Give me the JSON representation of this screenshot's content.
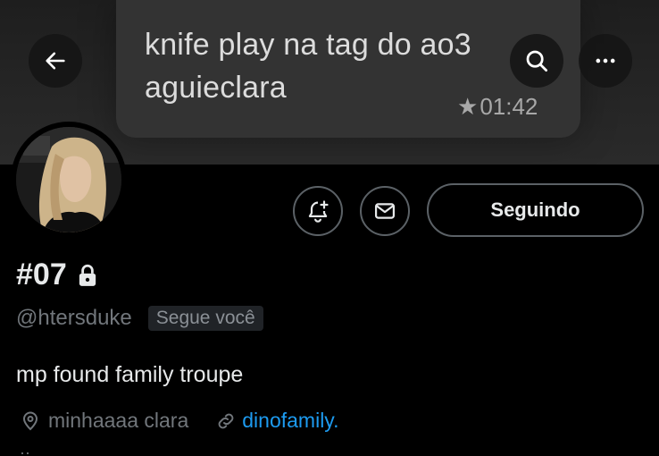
{
  "banner": {
    "text": "knife play na tag do ao3\naguieclara",
    "time": "01:42"
  },
  "profile": {
    "display_name": "#07",
    "handle": "@htersduke",
    "follows_you": "Segue você",
    "bio": "mp found family troupe",
    "location": "minhaaaa clara",
    "link": "dinofamily."
  },
  "actions": {
    "follow_label": "Seguindo"
  },
  "icons": {
    "back": "arrow-left-icon",
    "search": "search-icon",
    "more": "more-icon",
    "notify": "bell-plus-icon",
    "mail": "envelope-icon",
    "lock": "lock-icon",
    "location": "location-pin-icon",
    "link": "link-icon"
  },
  "colors": {
    "background": "#000000",
    "link": "#1d9bf0",
    "muted": "#71767b"
  }
}
